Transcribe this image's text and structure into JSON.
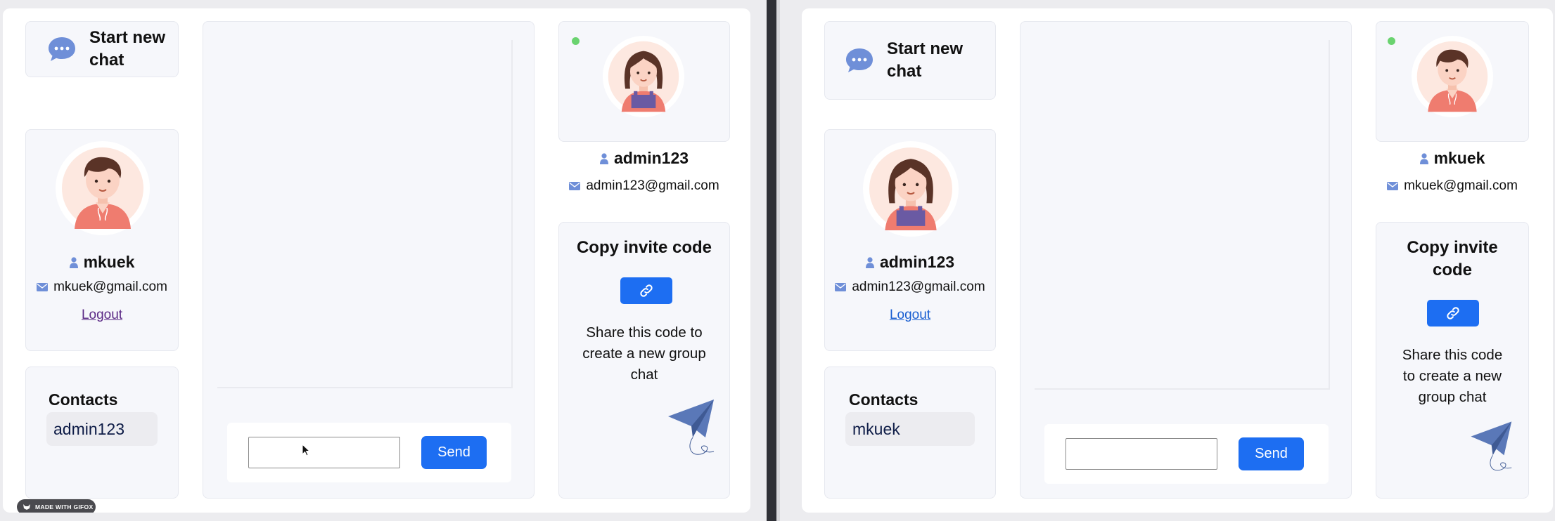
{
  "colors": {
    "accent": "#1d6ef2",
    "card_bg": "#f6f7fb",
    "online": "#6ad36f",
    "icon": "#6f8fd8"
  },
  "left": {
    "new_chat_label": "Start new chat",
    "profile": {
      "name": "mkuek",
      "email": "mkuek@gmail.com",
      "logout": "Logout",
      "avatar": "boy-avatar"
    },
    "contacts": {
      "title": "Contacts",
      "items": [
        "admin123"
      ]
    },
    "composer": {
      "input_value": "",
      "send_label": "Send"
    },
    "peer": {
      "name": "admin123",
      "email": "admin123@gmail.com",
      "avatar": "girl-avatar",
      "status": "online"
    },
    "invite": {
      "title": "Copy invite code",
      "share_text": "Share this code to create a new group chat"
    }
  },
  "right": {
    "new_chat_label": "Start new chat",
    "profile": {
      "name": "admin123",
      "email": "admin123@gmail.com",
      "logout": "Logout",
      "avatar": "girl-avatar"
    },
    "contacts": {
      "title": "Contacts",
      "items": [
        "mkuek"
      ]
    },
    "composer": {
      "input_value": "",
      "send_label": "Send"
    },
    "peer": {
      "name": "mkuek",
      "email": "mkuek@gmail.com",
      "avatar": "boy-avatar",
      "status": "online"
    },
    "invite": {
      "title": "Copy invite code",
      "share_text": "Share this code to create a new group chat"
    }
  },
  "watermark": "MADE WITH GIFOX"
}
